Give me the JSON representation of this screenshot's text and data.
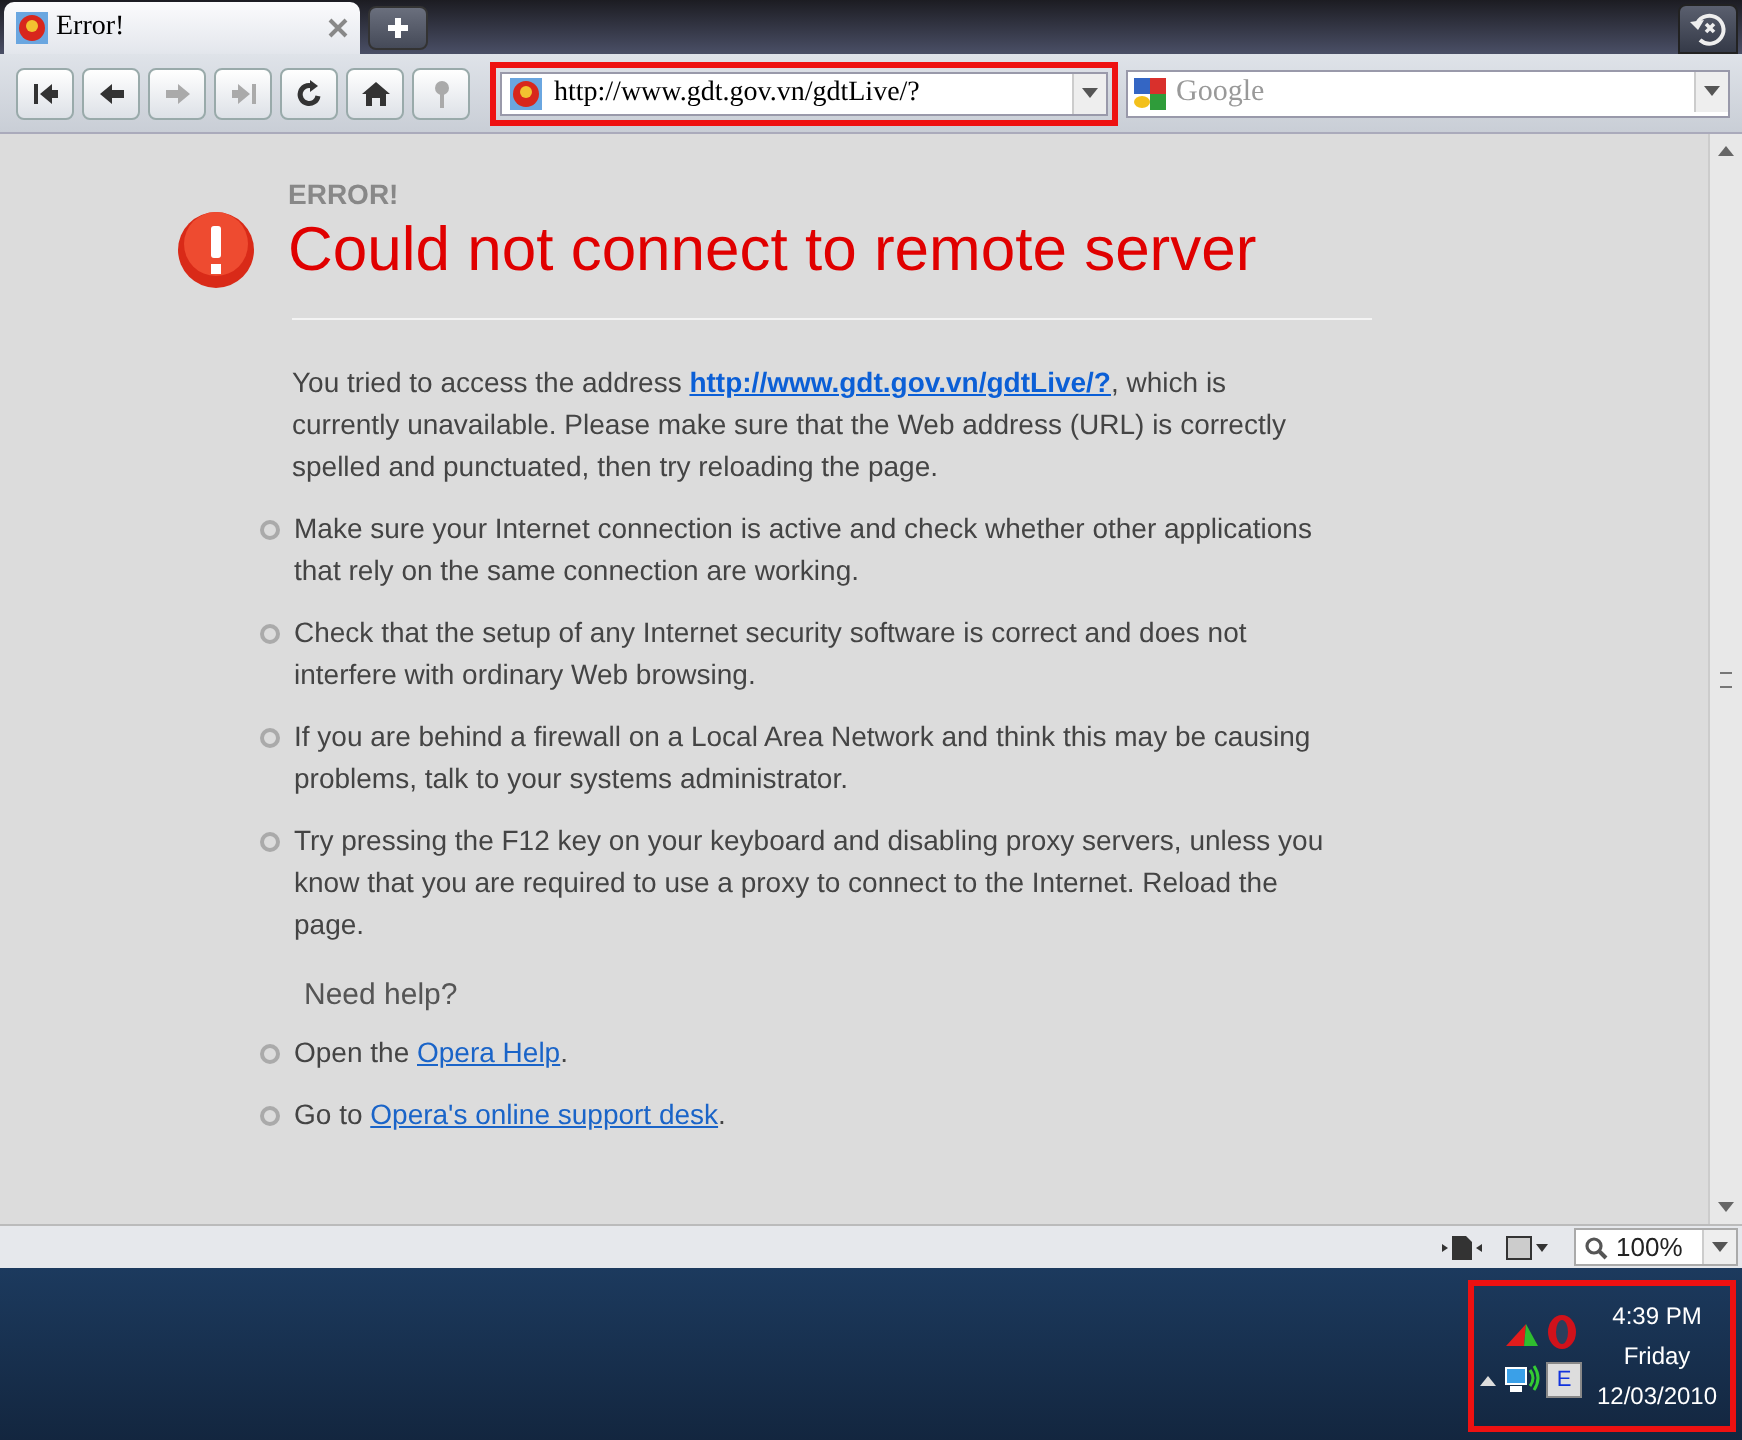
{
  "tabs": [
    {
      "title": "Error!",
      "selected": true
    }
  ],
  "toolbar": {
    "buttons": [
      {
        "kind": "rewind",
        "disabled": false
      },
      {
        "kind": "back",
        "disabled": false
      },
      {
        "kind": "forward",
        "disabled": true
      },
      {
        "kind": "fast_forward",
        "disabled": true
      },
      {
        "kind": "reload",
        "disabled": false
      },
      {
        "kind": "home",
        "disabled": false
      },
      {
        "kind": "key",
        "disabled": true
      }
    ],
    "address": {
      "value": "http://www.gdt.gov.vn/gdtLive/?",
      "highlighted": true
    },
    "search": {
      "placeholder": "Google"
    }
  },
  "page": {
    "label": "ERROR!",
    "title": "Could not connect to remote server",
    "intro": {
      "before": "You tried to access the address ",
      "link": "http://www.gdt.gov.vn/gdtLive/?",
      "after": ", which is currently unavailable. Please make sure that the Web address (URL) is correctly spelled and punctuated, then try reloading the page."
    },
    "tips": [
      "Make sure your Internet connection is active and check whether other applications that rely on the same connection are working.",
      "Check that the setup of any Internet security software is correct and does not interfere with ordinary Web browsing.",
      "If you are behind a firewall on a Local Area Network and think this may be causing problems, talk to your systems administrator.",
      "Try pressing the F12 key on your keyboard and disabling proxy servers, unless you know that you are required to use a proxy to connect to the Internet. Reload the page."
    ],
    "help_heading": "Need help?",
    "help_links": [
      {
        "before": "Open the ",
        "link": "Opera Help",
        "after": "."
      },
      {
        "before": "Go to ",
        "link": "Opera's online support desk",
        "after": "."
      }
    ]
  },
  "status_bar": {
    "zoom": "100%"
  },
  "tray": {
    "time": "4:39 PM",
    "day": "Friday",
    "date": "12/03/2010",
    "key_label": "E",
    "highlighted": true
  }
}
